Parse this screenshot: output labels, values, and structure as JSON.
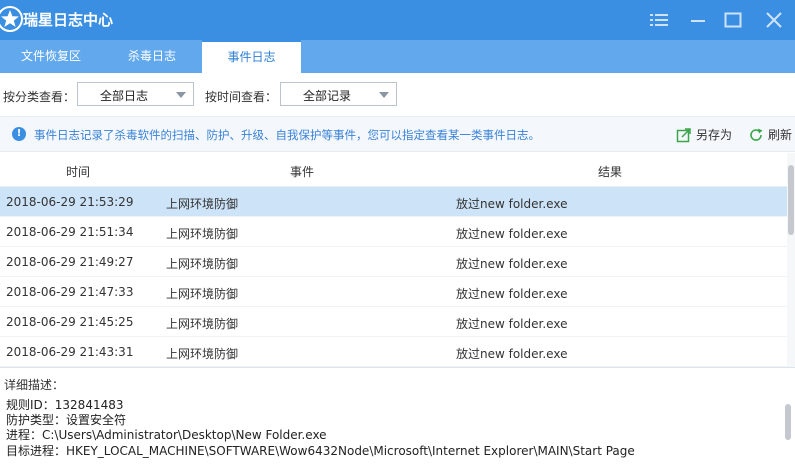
{
  "app": {
    "title": "瑞星日志中心"
  },
  "tabs": [
    {
      "label": "文件恢复区",
      "active": false
    },
    {
      "label": "杀毒日志",
      "active": false
    },
    {
      "label": "事件日志",
      "active": true
    }
  ],
  "filters": {
    "category_label": "按分类查看：",
    "category_value": "全部日志",
    "time_label": "按时间查看：",
    "time_value": "全部记录"
  },
  "info": {
    "text": "事件日志记录了杀毒软件的扫描、防护、升级、自我保护等事件，您可以指定查看某一类事件日志。",
    "save_as": "另存为",
    "refresh": "刷新"
  },
  "table": {
    "headers": [
      "时间",
      "事件",
      "结果"
    ],
    "rows": [
      {
        "time": "2018-06-29 21:53:29",
        "event": "上网环境防御",
        "result": "放过new folder.exe",
        "selected": true
      },
      {
        "time": "2018-06-29 21:51:34",
        "event": "上网环境防御",
        "result": "放过new folder.exe",
        "selected": false
      },
      {
        "time": "2018-06-29 21:49:27",
        "event": "上网环境防御",
        "result": "放过new folder.exe",
        "selected": false
      },
      {
        "time": "2018-06-29 21:47:33",
        "event": "上网环境防御",
        "result": "放过new folder.exe",
        "selected": false
      },
      {
        "time": "2018-06-29 21:45:25",
        "event": "上网环境防御",
        "result": "放过new folder.exe",
        "selected": false
      },
      {
        "time": "2018-06-29 21:43:31",
        "event": "上网环境防御",
        "result": "放过new folder.exe",
        "selected": false
      }
    ]
  },
  "detail": {
    "title": "详细描述：",
    "lines": [
      "规则ID：132841483",
      "防护类型：设置安全符",
      "进程：C:\\Users\\Administrator\\Desktop\\New Folder.exe",
      "目标进程：HKEY_LOCAL_MACHINE\\SOFTWARE\\Wow6432Node\\Microsoft\\Internet Explorer\\MAIN\\Start Page"
    ]
  },
  "icons": {
    "logo": "rising-star-logo-icon",
    "menu": "menu-icon",
    "minimize": "minimize-icon",
    "maximize": "maximize-icon",
    "close": "close-icon",
    "info": "info-icon",
    "save_as": "export-icon",
    "refresh": "refresh-icon"
  },
  "colors": {
    "titlebar": "#3b8fe3",
    "tabbar": "#62a8ec",
    "selected_row": "#cde3f8",
    "info_text": "#3a82d8",
    "save_icon": "#3aa54a",
    "refresh_icon": "#3aa54a"
  }
}
